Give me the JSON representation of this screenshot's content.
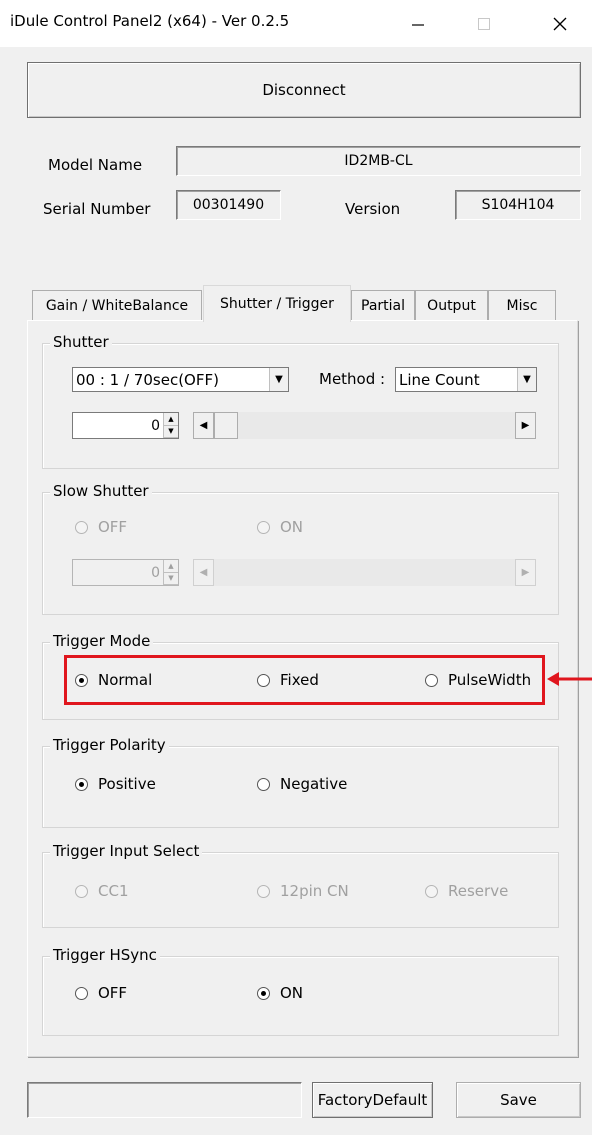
{
  "window": {
    "title": "iDule Control Panel2 (x64) - Ver 0.2.5"
  },
  "titlebar_buttons": {
    "minimize": "—",
    "maximize": "☐",
    "close": "✕"
  },
  "connect": {
    "label": "Disconnect"
  },
  "info": {
    "model_label": "Model Name",
    "model_value": "ID2MB-CL",
    "serial_label": "Serial Number",
    "serial_value": "00301490",
    "version_label": "Version",
    "version_value": "S104H104"
  },
  "tabs": [
    {
      "label": "Gain / WhiteBalance",
      "active": false
    },
    {
      "label": "Shutter / Trigger",
      "active": true
    },
    {
      "label": "Partial",
      "active": false
    },
    {
      "label": "Output",
      "active": false
    },
    {
      "label": "Misc",
      "active": false
    }
  ],
  "shutter": {
    "title": "Shutter",
    "value_select": "00 : 1 / 70sec(OFF)",
    "method_label": "Method :",
    "method_select": "Line Count",
    "spin_value": "0"
  },
  "slow_shutter": {
    "title": "Slow Shutter",
    "off_label": "OFF",
    "on_label": "ON",
    "spin_value": "0"
  },
  "trigger_mode": {
    "title": "Trigger Mode",
    "options": [
      "Normal",
      "Fixed",
      "PulseWidth"
    ],
    "selected": "Normal"
  },
  "trigger_polarity": {
    "title": "Trigger Polarity",
    "options": [
      "Positive",
      "Negative"
    ],
    "selected": "Positive"
  },
  "trigger_input": {
    "title": "Trigger Input Select",
    "options": [
      "CC1",
      "12pin CN",
      "Reserve"
    ]
  },
  "trigger_hsync": {
    "title": "Trigger HSync",
    "options": [
      "OFF",
      "ON"
    ],
    "selected": "ON"
  },
  "footer": {
    "factory_default": "FactoryDefault",
    "save": "Save"
  },
  "colors": {
    "highlight": "#e0161e",
    "window_bg": "#f0f0f0"
  }
}
